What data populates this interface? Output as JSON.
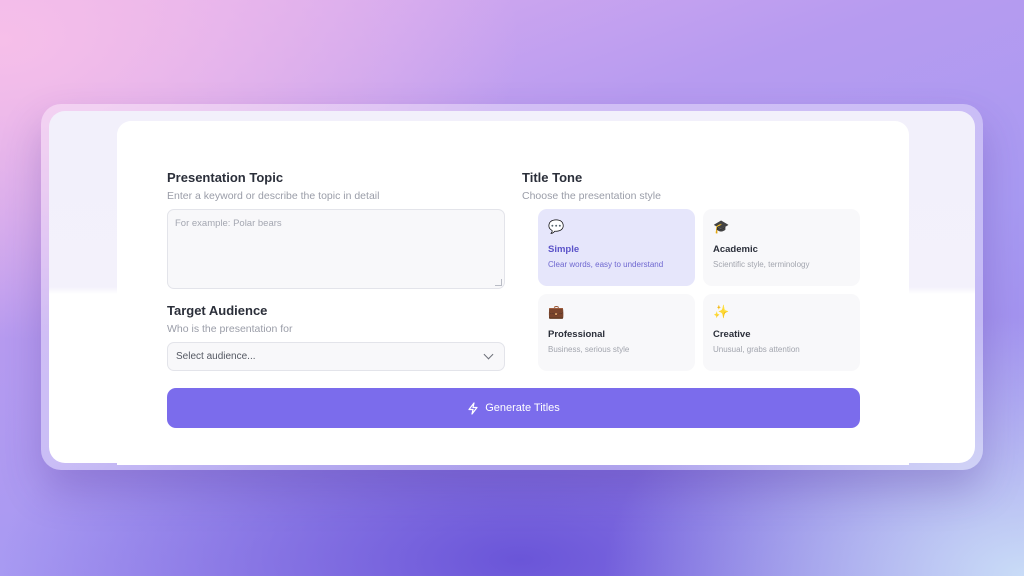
{
  "topic": {
    "heading": "Presentation Topic",
    "subtitle": "Enter a keyword or describe the topic in detail",
    "placeholder": "For example: Polar bears"
  },
  "audience": {
    "heading": "Target Audience",
    "subtitle": "Who is the presentation for",
    "selected": "Select audience..."
  },
  "tone": {
    "heading": "Title Tone",
    "subtitle": "Choose the presentation style",
    "options": [
      {
        "name": "Simple",
        "desc": "Clear words, easy to understand",
        "icon": "💬",
        "icon_name": "speech-bubble-icon",
        "selected": true
      },
      {
        "name": "Academic",
        "desc": "Scientific style, terminology",
        "icon": "🎓",
        "icon_name": "graduation-cap-icon",
        "selected": false
      },
      {
        "name": "Professional",
        "desc": "Business, serious style",
        "icon": "💼",
        "icon_name": "briefcase-icon",
        "selected": false
      },
      {
        "name": "Creative",
        "desc": "Unusual, grabs attention",
        "icon": "✨",
        "icon_name": "sparkle-icon",
        "selected": false
      }
    ]
  },
  "generate_label": "Generate Titles",
  "colors": {
    "accent": "#7b6cec",
    "selected_tile": "#e6e6fb"
  }
}
